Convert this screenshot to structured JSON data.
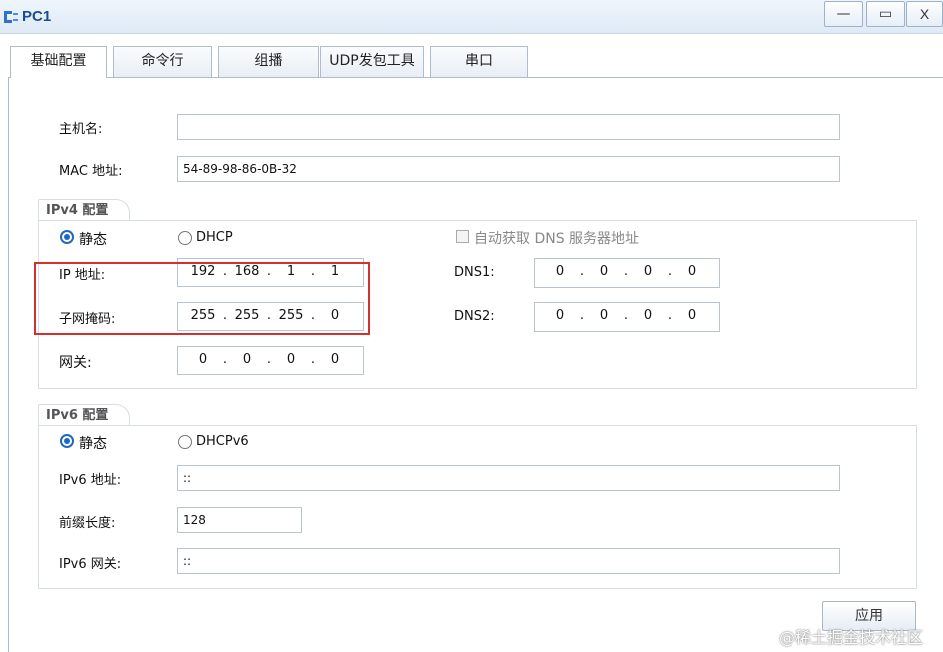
{
  "window": {
    "title": "PC1",
    "minimize_glyph": "—",
    "maximize_glyph": "▭",
    "close_glyph": "X",
    "icon": "network-pc-icon"
  },
  "tabs": [
    {
      "label": "基础配置",
      "active": true
    },
    {
      "label": "命令行",
      "active": false
    },
    {
      "label": "组播",
      "active": false
    },
    {
      "label": "UDP发包工具",
      "active": false
    },
    {
      "label": "串口",
      "active": false
    }
  ],
  "basic": {
    "hostname_label": "主机名:",
    "hostname_value": "",
    "mac_label": "MAC 地址:",
    "mac_value": "54-89-98-86-0B-32"
  },
  "ipv4": {
    "group_title": "IPv4 配置",
    "static_label": "静态",
    "dhcp_label": "DHCP",
    "mode": "static",
    "auto_dns_label": "自动获取 DNS 服务器地址",
    "auto_dns_checked": false,
    "ip_label": "IP 地址:",
    "ip": [
      "192",
      "168",
      "1",
      "1"
    ],
    "mask_label": "子网掩码:",
    "mask": [
      "255",
      "255",
      "255",
      "0"
    ],
    "gateway_label": "网关:",
    "gateway": [
      "0",
      "0",
      "0",
      "0"
    ],
    "dns1_label": "DNS1:",
    "dns1": [
      "0",
      "0",
      "0",
      "0"
    ],
    "dns2_label": "DNS2:",
    "dns2": [
      "0",
      "0",
      "0",
      "0"
    ],
    "dot": "."
  },
  "ipv6": {
    "group_title": "IPv6 配置",
    "static_label": "静态",
    "dhcp_label": "DHCPv6",
    "mode": "static",
    "address_label": "IPv6 地址:",
    "address_value": "::",
    "prefix_label": "前缀长度:",
    "prefix_value": "128",
    "gateway_label": "IPv6 网关:",
    "gateway_value": "::"
  },
  "apply_label": "应用",
  "watermark": "@稀土掘金技术社区",
  "colors": {
    "highlight": "#d43030",
    "radio_accent": "#1f67c3",
    "title_text": "#1a4f8f"
  }
}
